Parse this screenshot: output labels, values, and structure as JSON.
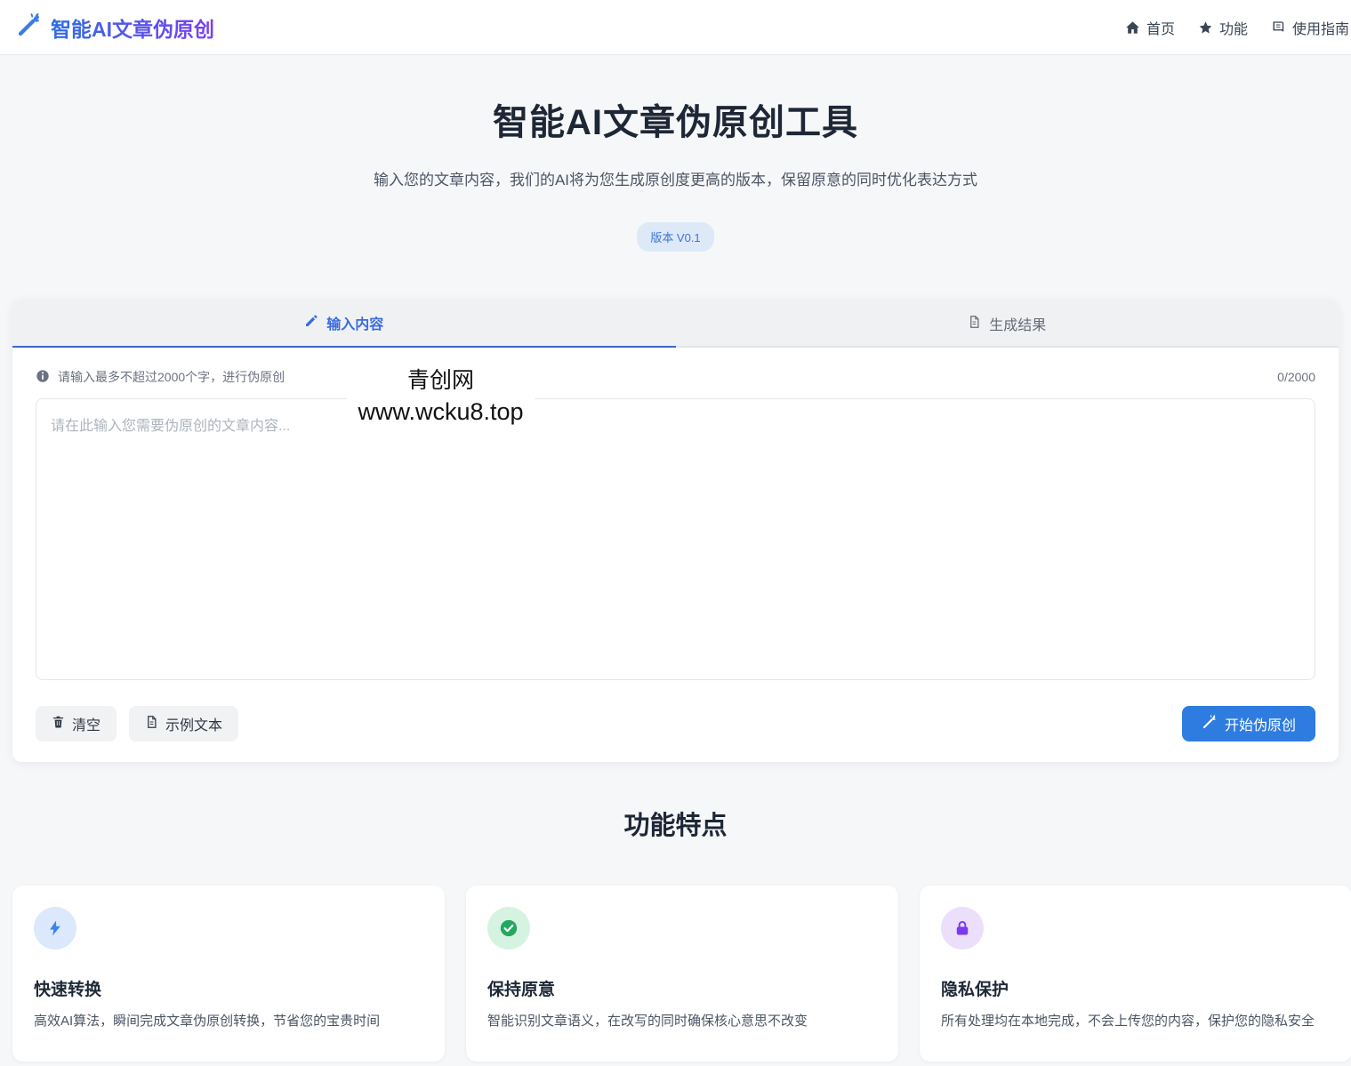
{
  "brand": {
    "name": "智能AI文章伪原创"
  },
  "nav": {
    "home": "首页",
    "features": "功能",
    "guide": "使用指南"
  },
  "hero": {
    "title": "智能AI文章伪原创工具",
    "subtitle": "输入您的文章内容，我们的AI将为您生成原创度更高的版本，保留原意的同时优化表达方式",
    "version_badge": "版本 V0.1"
  },
  "editor": {
    "tab_input": "输入内容",
    "tab_result": "生成结果",
    "hint": "请输入最多不超过2000个字，进行伪原创",
    "counter": "0/2000",
    "placeholder": "请在此输入您需要伪原创的文章内容...",
    "clear_label": "清空",
    "sample_label": "示例文本",
    "start_label": "开始伪原创"
  },
  "watermark": {
    "line1": "青创网",
    "line2": "www.wcku8.top"
  },
  "features": {
    "heading": "功能特点",
    "cards": [
      {
        "title": "快速转换",
        "desc": "高效AI算法，瞬间完成文章伪原创转换，节省您的宝贵时间"
      },
      {
        "title": "保持原意",
        "desc": "智能识别文章语义，在改写的同时确保核心意思不改变"
      },
      {
        "title": "隐私保护",
        "desc": "所有处理均在本地完成，不会上传您的内容，保护您的隐私安全"
      }
    ]
  },
  "colors": {
    "primary_blue": "#2e7ce0",
    "tab_active_blue": "#3a66d1",
    "brand_gradient_start": "#2e6de4",
    "brand_gradient_end": "#7b3ff2",
    "feature_blue": "#3b82f6",
    "feature_green": "#22a85f",
    "feature_purple": "#7c3aed",
    "page_bg": "#f6f7f9"
  }
}
